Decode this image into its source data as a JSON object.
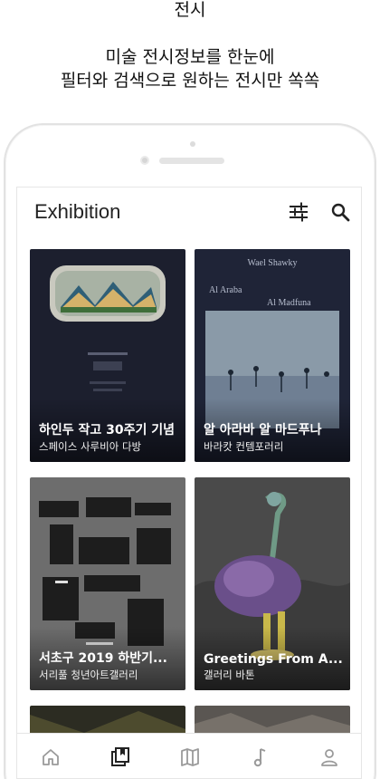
{
  "promo": {
    "heading": "전시",
    "subtitle_line1": "미술 전시정보를 한눈에",
    "subtitle_line2": "필터와 검색으로 원하는 전시만 쏙쏙"
  },
  "app": {
    "title": "Exhibition",
    "header_icons": [
      "filter-sliders-icon",
      "search-icon"
    ]
  },
  "exhibitions": [
    {
      "title": "하인두 작고 30주기 기념",
      "venue": "스페이스 사루비아 다방"
    },
    {
      "title": "알 아라바 알 마드푸나",
      "venue": "바라캇 컨템포러리",
      "poster_artist": "Wael Shawky",
      "poster_title_line1": "Al Araba",
      "poster_title_line2": "Al Madfuna"
    },
    {
      "title": "서초구 2019 하반기...",
      "venue": "서리풀 청년아트갤러리"
    },
    {
      "title": "Greetings From A...",
      "venue": "갤러리 바톤"
    }
  ],
  "bottom_nav": [
    {
      "icon": "home-icon",
      "active": false
    },
    {
      "icon": "exhibition-book-icon",
      "active": true
    },
    {
      "icon": "map-icon",
      "active": false
    },
    {
      "icon": "music-note-icon",
      "active": false
    },
    {
      "icon": "profile-icon",
      "active": false
    }
  ],
  "colors": {
    "active_nav": "#222222",
    "inactive_nav": "#9a9a9a",
    "card1_bg": "#1c1f2e",
    "card2_bg": "#1f2437",
    "card3_bg": "#6d6d6d",
    "card4_bg": "#4a4a4a"
  }
}
